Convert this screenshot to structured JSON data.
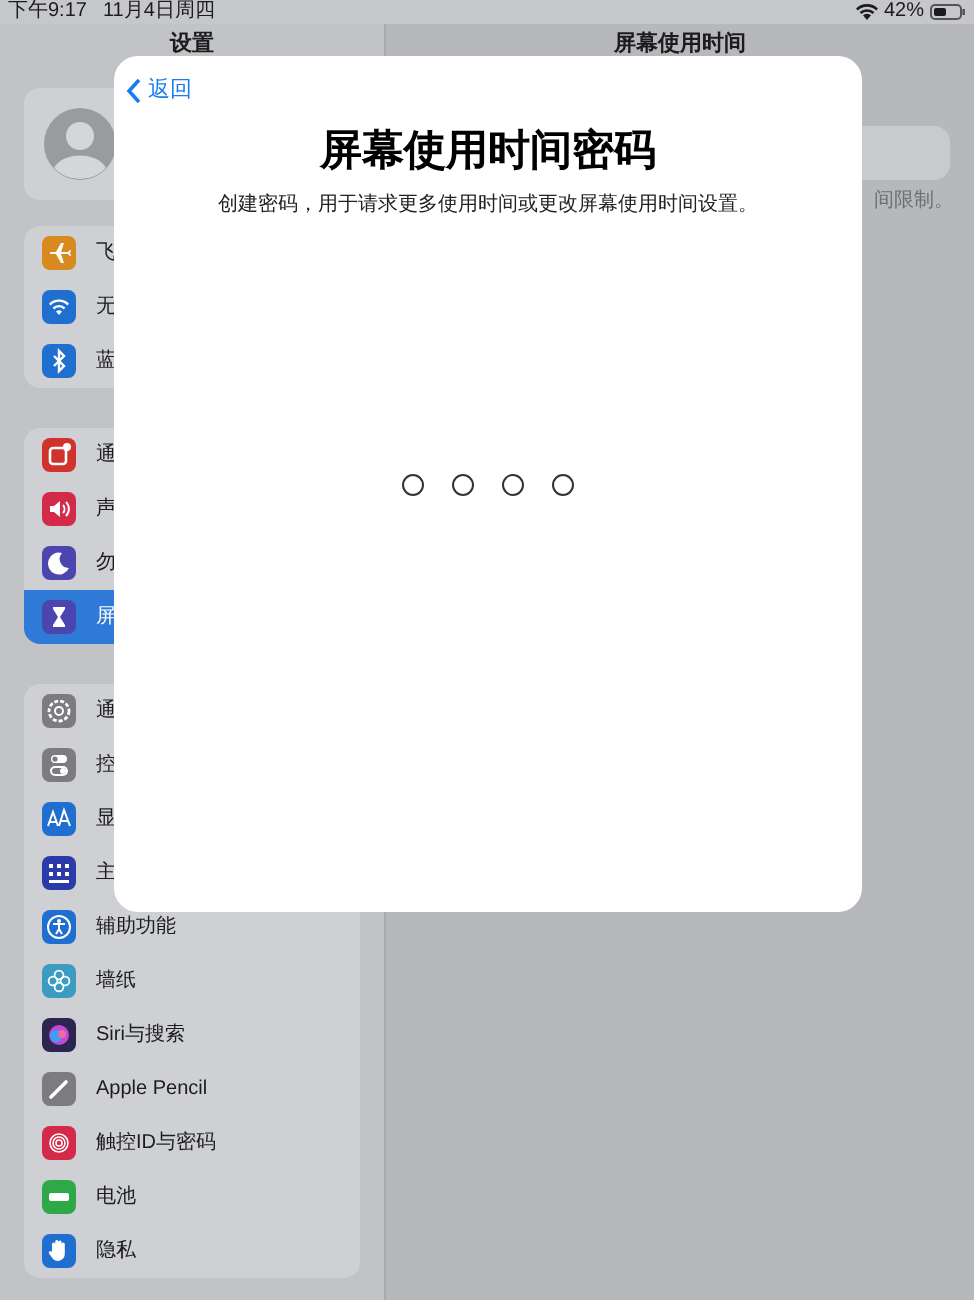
{
  "status_bar": {
    "time": "下午9:17",
    "date": "11月4日周四",
    "battery": "42%"
  },
  "sidebar": {
    "title": "设置",
    "groups": [
      [
        {
          "label": "飞",
          "selected": false,
          "color": "#d98a1e"
        },
        {
          "label": "无",
          "selected": false,
          "color": "#1f6fd0"
        },
        {
          "label": "蓝",
          "selected": false,
          "color": "#1f6fd0"
        }
      ],
      [
        {
          "label": "通",
          "selected": false,
          "color": "#d0332c"
        },
        {
          "label": "声",
          "selected": false,
          "color": "#d42a4a"
        },
        {
          "label": "勿",
          "selected": false,
          "color": "#4b45b0"
        },
        {
          "label": "屏",
          "selected": true,
          "color": "#4b45b0"
        }
      ],
      [
        {
          "label": "通",
          "selected": false,
          "color": "#7c7c80"
        },
        {
          "label": "控",
          "selected": false,
          "color": "#7c7c80"
        },
        {
          "label": "显",
          "selected": false,
          "color": "#1f6fd0"
        },
        {
          "label": "主",
          "selected": false,
          "color": "#2a3aa8"
        },
        {
          "label": "辅助功能",
          "selected": false,
          "color": "#1f6fd0"
        },
        {
          "label": "墙纸",
          "selected": false,
          "color": "#3a9cc0"
        },
        {
          "label": "Siri与搜索",
          "selected": false,
          "color": "#2b2550"
        },
        {
          "label": "Apple Pencil",
          "selected": false,
          "color": "#7c7c80"
        },
        {
          "label": "触控ID与密码",
          "selected": false,
          "color": "#d42a4a"
        },
        {
          "label": "电池",
          "selected": false,
          "color": "#2fa84a"
        },
        {
          "label": "隐私",
          "selected": false,
          "color": "#1f6fd0"
        }
      ]
    ]
  },
  "detail": {
    "title": "屏幕使用时间",
    "note": "间限制。"
  },
  "modal": {
    "back": "返回",
    "title": "屏幕使用时间密码",
    "subtitle": "创建密码，用于请求更多使用时间或更改屏幕使用时间设置。",
    "digits": [
      {
        "filled": false
      },
      {
        "filled": false
      },
      {
        "filled": false
      },
      {
        "filled": false
      }
    ]
  }
}
